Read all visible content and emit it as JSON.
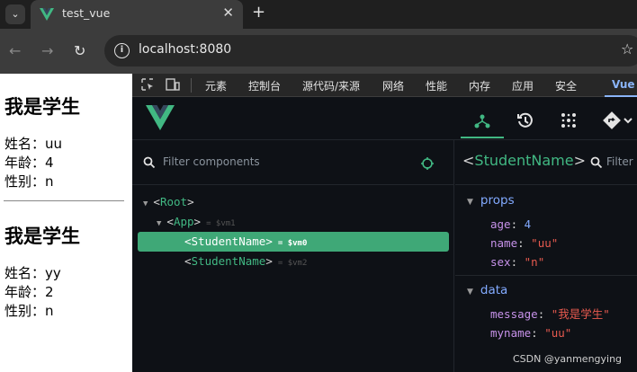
{
  "browser": {
    "tab_title": "test_vue",
    "close_glyph": "✕",
    "newtab_glyph": "+",
    "back_glyph": "←",
    "forward_glyph": "→",
    "reload_glyph": "↻",
    "url": "localhost:8080",
    "star_glyph": "☆"
  },
  "page": {
    "students": [
      {
        "heading": "我是学生",
        "name": "姓名：uu",
        "age": "年龄：4",
        "sex": "性别：n"
      },
      {
        "heading": "我是学生",
        "name": "姓名：yy",
        "age": "年龄：2",
        "sex": "性别：n"
      }
    ]
  },
  "devtools": {
    "tabs": [
      "元素",
      "控制台",
      "源代码/来源",
      "网络",
      "性能",
      "内存",
      "应用",
      "安全",
      "Vue"
    ],
    "active_tab": "Vue"
  },
  "vue": {
    "filter_placeholder": "Filter components",
    "tree": [
      {
        "arrow": "▼",
        "name": "Root",
        "vm": ""
      },
      {
        "arrow": "▼",
        "name": "App",
        "vm": "= $vm1"
      },
      {
        "arrow": "",
        "name": "StudentName",
        "vm": "= $vm0"
      },
      {
        "arrow": "",
        "name": "StudentName",
        "vm": "= $vm2"
      }
    ],
    "selected": {
      "name": "StudentName",
      "filter_text": "Filter",
      "props_title": "props",
      "props": [
        {
          "key": "age",
          "value": "4",
          "type": "number"
        },
        {
          "key": "name",
          "value": "\"uu\"",
          "type": "string"
        },
        {
          "key": "sex",
          "value": "\"n\"",
          "type": "string"
        }
      ],
      "data_title": "data",
      "data": [
        {
          "key": "message",
          "value": "\"我是学生\"",
          "type": "string"
        },
        {
          "key": "myname",
          "value": "\"uu\"",
          "type": "string"
        }
      ]
    }
  },
  "watermark": "CSDN @yanmengying",
  "colors": {
    "vue_green": "#41b883",
    "selected_row": "#3fa877",
    "prop_key": "#c792ea",
    "string_value": "#e85a4f",
    "number_value": "#82aaff"
  }
}
